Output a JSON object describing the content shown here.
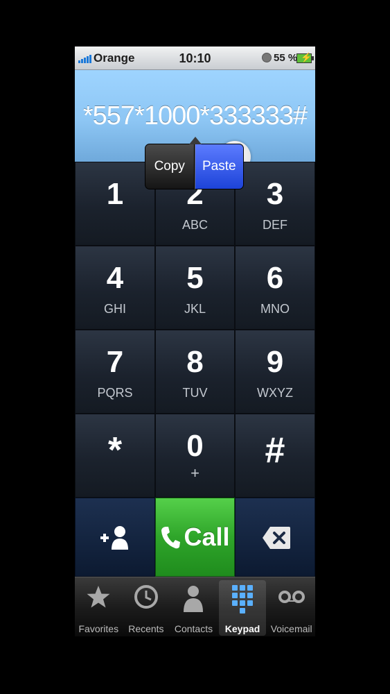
{
  "status_bar": {
    "carrier": "Orange",
    "time": "10:10",
    "battery": "55 %"
  },
  "display": {
    "number": "*557*1000*333333#"
  },
  "edit_menu": {
    "copy_label": "Copy",
    "paste_label": "Paste"
  },
  "keys": [
    {
      "digit": "1",
      "letters": ""
    },
    {
      "digit": "2",
      "letters": "ABC"
    },
    {
      "digit": "3",
      "letters": "DEF"
    },
    {
      "digit": "4",
      "letters": "GHI"
    },
    {
      "digit": "5",
      "letters": "JKL"
    },
    {
      "digit": "6",
      "letters": "MNO"
    },
    {
      "digit": "7",
      "letters": "PQRS"
    },
    {
      "digit": "8",
      "letters": "TUV"
    },
    {
      "digit": "9",
      "letters": "WXYZ"
    },
    {
      "digit": "*",
      "letters": ""
    },
    {
      "digit": "0",
      "letters": "+"
    },
    {
      "digit": "#",
      "letters": ""
    }
  ],
  "actions": {
    "call_label": "Call",
    "call_color": "#2fa52a"
  },
  "tabs": [
    {
      "label": "Favorites",
      "icon": "star-icon"
    },
    {
      "label": "Recents",
      "icon": "clock-icon"
    },
    {
      "label": "Contacts",
      "icon": "person-icon"
    },
    {
      "label": "Keypad",
      "icon": "keypad-icon",
      "active": true
    },
    {
      "label": "Voicemail",
      "icon": "voicemail-icon"
    }
  ]
}
